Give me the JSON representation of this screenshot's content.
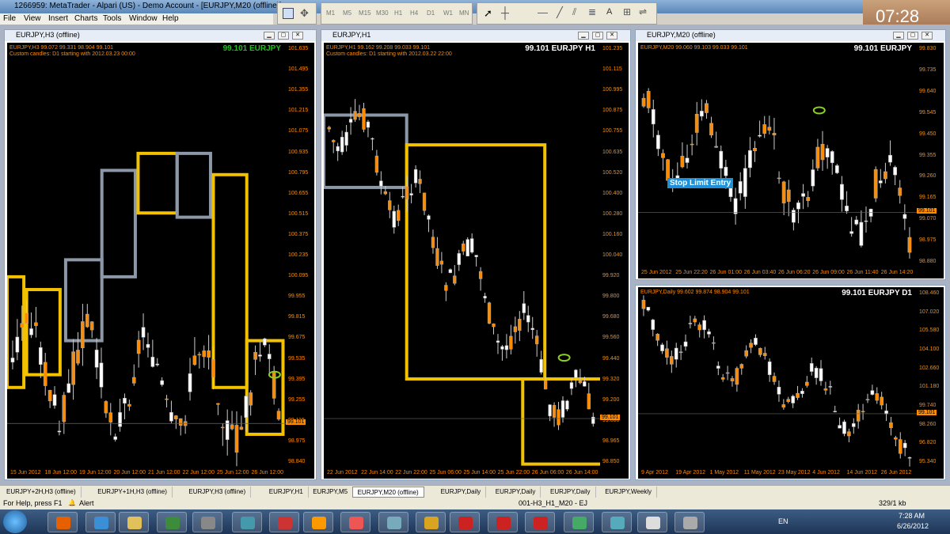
{
  "app": {
    "title": "1266959: MetaTrader - Alpari (US) - Demo Account - [EURJPY,M20 (offline)]",
    "menu": [
      "File",
      "View",
      "Insert",
      "Charts",
      "Tools",
      "Window",
      "Help"
    ],
    "timeframes": [
      "M1",
      "M5",
      "M15",
      "M30",
      "H1",
      "H4",
      "D1",
      "W1",
      "MN"
    ],
    "clock": "07:28"
  },
  "charts": [
    {
      "id": "h3",
      "window_title": "EURJPY,H3 (offline)",
      "info1": "EURJPY,H3  99.072 99.331 98.904 99.101",
      "info2": "Custom candles: D1 starting with 2012.03.23 00:00",
      "big_label": "99.101 EURJPY",
      "big_color": "#1fbf1f",
      "price_labels": [
        "101.635",
        "101.495",
        "101.355",
        "101.215",
        "101.075",
        "100.935",
        "100.795",
        "100.655",
        "100.515",
        "100.375",
        "100.235",
        "100.095",
        "99.955",
        "99.815",
        "99.675",
        "99.535",
        "99.395",
        "99.255",
        "99.115",
        "98.975",
        "98.840"
      ],
      "time_labels": [
        "15 Jun 2012",
        "18 Jun 12:00",
        "19 Jun 12:00",
        "20 Jun 12:00",
        "21 Jun 12:00",
        "22 Jun 12:00",
        "25 Jun 12:00",
        "26 Jun 12:00"
      ],
      "current_price": "99.101",
      "chart_data": {
        "type": "candlestick",
        "y_range": [
          98.84,
          101.635
        ],
        "last_close": 99.101
      }
    },
    {
      "id": "h1",
      "window_title": "EURJPY,H1",
      "info1": "EURJPY,H1  99.162 99.208 99.033 99.101",
      "info2": "Custom candles: D1 starting with 2012.03.22 22:00",
      "big_label": "99.101 EURJPY H1",
      "big_color": "#ffffff",
      "price_labels": [
        "101.235",
        "101.115",
        "100.995",
        "100.875",
        "100.755",
        "100.635",
        "100.520",
        "100.400",
        "100.280",
        "100.160",
        "100.040",
        "99.920",
        "99.800",
        "99.680",
        "99.560",
        "99.440",
        "99.320",
        "99.200",
        "99.080",
        "98.965",
        "98.850"
      ],
      "time_labels": [
        "22 Jun 2012",
        "22 Jun 14:00",
        "22 Jun 22:00",
        "25 Jun 06:00",
        "25 Jun 14:00",
        "25 Jun 22:00",
        "26 Jun 06:00",
        "26 Jun 14:00"
      ],
      "current_price": "99.101",
      "chart_data": {
        "type": "candlestick",
        "y_range": [
          98.85,
          101.235
        ],
        "last_close": 99.101
      }
    },
    {
      "id": "m20",
      "window_title": "EURJPY,M20 (offline)",
      "info1": "EURJPY,M20  99.060 99.103 99.033 99.101",
      "big_label": "99.101 EURJPY",
      "big_color": "#ffffff",
      "price_labels": [
        "99.830",
        "99.735",
        "99.640",
        "99.545",
        "99.450",
        "99.355",
        "99.260",
        "99.165",
        "99.070",
        "98.975",
        "98.880"
      ],
      "time_labels": [
        "25 Jun 2012",
        "25 Jun 22:20",
        "26 Jun 01:00",
        "26 Jun 03:40",
        "26 Jun 06:20",
        "26 Jun 09:00",
        "26 Jun 11:40",
        "26 Jun 14:20"
      ],
      "current_price": "99.101",
      "annotation": "Stop Limit Entry",
      "chart_data": {
        "type": "candlestick",
        "y_range": [
          98.88,
          99.83
        ],
        "last_close": 99.101
      }
    },
    {
      "id": "d1",
      "window_title": "EURJPY,Daily",
      "info1": "EURJPY,Daily  99.602 99.874 98.904 99.101",
      "big_label": "99.101 EURJPY D1",
      "big_color": "#ffffff",
      "price_labels": [
        "108.460",
        "107.020",
        "105.580",
        "104.100",
        "102.660",
        "101.180",
        "99.740",
        "98.260",
        "96.820",
        "95.340"
      ],
      "time_labels": [
        "9 Apr 2012",
        "19 Apr 2012",
        "1 May 2012",
        "11 May 2012",
        "23 May 2012",
        "4 Jun 2012",
        "14 Jun 2012",
        "26 Jun 2012"
      ],
      "current_price": "99.101",
      "chart_data": {
        "type": "candlestick",
        "y_range": [
          95.34,
          108.46
        ],
        "last_close": 99.101
      }
    }
  ],
  "tabs": [
    "EURJPY+2H,H3 (offline)",
    "EURJPY+1H,H3 (offline)",
    "EURJPY,H3 (offline)",
    "EURJPY,H1",
    "EURJPY,M5",
    "EURJPY,M20 (offline)",
    "EURJPY,Daily",
    "EURJPY,Daily",
    "EURJPY,Daily",
    "EURJPY,Weekly"
  ],
  "active_tab": 5,
  "status": {
    "help": "For Help, press F1",
    "alert": "Alert",
    "profile": "001-H3_H1_M20 - EJ",
    "traffic": "329/1 kb"
  },
  "taskbar": {
    "lang": "EN",
    "time": "7:28 AM",
    "date": "6/26/2012"
  }
}
